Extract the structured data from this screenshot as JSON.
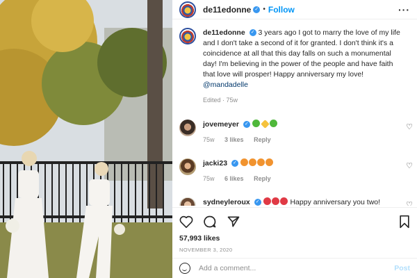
{
  "post": {
    "username": "de11edonne",
    "follow_label": "Follow",
    "caption_text": "3 years ago I got to marry the love of my life and I don't take a second of it for granted. I don't think it's a coincidence at all that this day falls on such a monumental day! I'm believing in the power of the people and have faith that love will prosper! Happy anniversary my love!",
    "caption_mention": "@mandadelle",
    "edited_label": "Edited",
    "edited_time": "75w"
  },
  "comments": [
    {
      "username": "jovemeyer",
      "text": "",
      "emojis": [
        "green-heart",
        "sparkle",
        "green-heart"
      ],
      "time": "75w",
      "likes": "3 likes",
      "reply": "Reply"
    },
    {
      "username": "jacki23",
      "text": "",
      "emojis": [
        "smile",
        "smile",
        "smile",
        "smile"
      ],
      "time": "75w",
      "likes": "6 likes",
      "reply": "Reply"
    },
    {
      "username": "sydneyleroux",
      "text": "Happy anniversary you two!",
      "emojis": [
        "red-heart",
        "red-heart",
        "red-heart"
      ],
      "time": "",
      "likes": "",
      "reply": ""
    }
  ],
  "stats": {
    "likes": "57,993 likes",
    "date": "NOVEMBER 3, 2020"
  },
  "composer": {
    "placeholder": "Add a comment...",
    "post_label": "Post"
  },
  "colors": {
    "follow": "#0095f6",
    "verified": "#3897f0",
    "muted": "#8e8e8e"
  }
}
